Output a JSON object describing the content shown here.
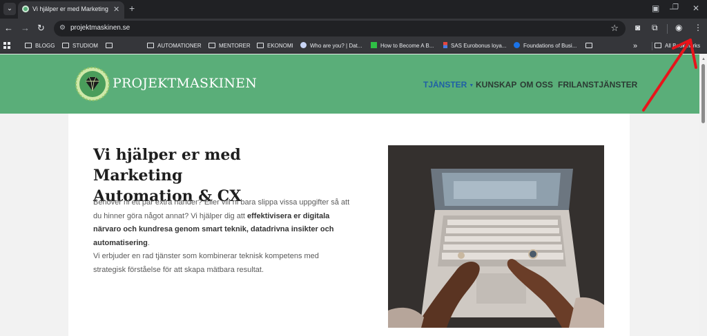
{
  "browser": {
    "tab": {
      "title": "Vi hjälper er med Marketing Automation & CX"
    },
    "address": {
      "url": "projektmaskinen.se"
    },
    "bookmarks": [
      {
        "label": "BLOGG",
        "type": "folder"
      },
      {
        "label": "STUDIOM",
        "type": "folder"
      },
      {
        "label": "",
        "type": "folder"
      },
      {
        "label": "AUTOMATIONER",
        "type": "folder"
      },
      {
        "label": "MENTORER",
        "type": "folder"
      },
      {
        "label": "EKONOMI",
        "type": "folder"
      },
      {
        "label": "Who are you? | Dat...",
        "type": "link"
      },
      {
        "label": "How to Become A B...",
        "type": "link"
      },
      {
        "label": "SAS Eurobonus loya...",
        "type": "link"
      },
      {
        "label": "Foundations of Busi...",
        "type": "link"
      },
      {
        "label": "",
        "type": "folder"
      }
    ],
    "overflow_label": "»",
    "all_bookmarks_label": "All Bookmarks"
  },
  "site": {
    "logo_text": "PROJEKTMASKINEN",
    "nav": [
      {
        "label": "TJÄNSTER",
        "active": true,
        "dropdown": true
      },
      {
        "label": "KUNSKAP"
      },
      {
        "label": "OM OSS"
      },
      {
        "label": "FRILANSTJÄNSTER"
      }
    ],
    "hero": {
      "title_line1": "Vi hjälper er med Marketing",
      "title_line2": "Automation & CX",
      "p1_line1": "Behöver ni ett par extra händer? Eller vill ni bara slippa vissa uppgifter så att",
      "p1_line2": "du hinner göra något annat? Vi hjälper dig att ",
      "p1_bold1": "effektivisera er digitala",
      "p1_bold2": "närvaro och kundresa genom smart teknik, datadrivna insikter och",
      "p1_bold3": "automatisering",
      "p1_end": ".",
      "p2_line1": "Vi erbjuder en rad tjänster som kombinerar teknisk kompetens med",
      "p2_line2": "strategisk förståelse för att skapa mätbara resultat."
    }
  },
  "colors": {
    "header_green": "#5aae79",
    "nav_active": "#1f5fa6",
    "annotation_arrow": "#e8141b"
  }
}
